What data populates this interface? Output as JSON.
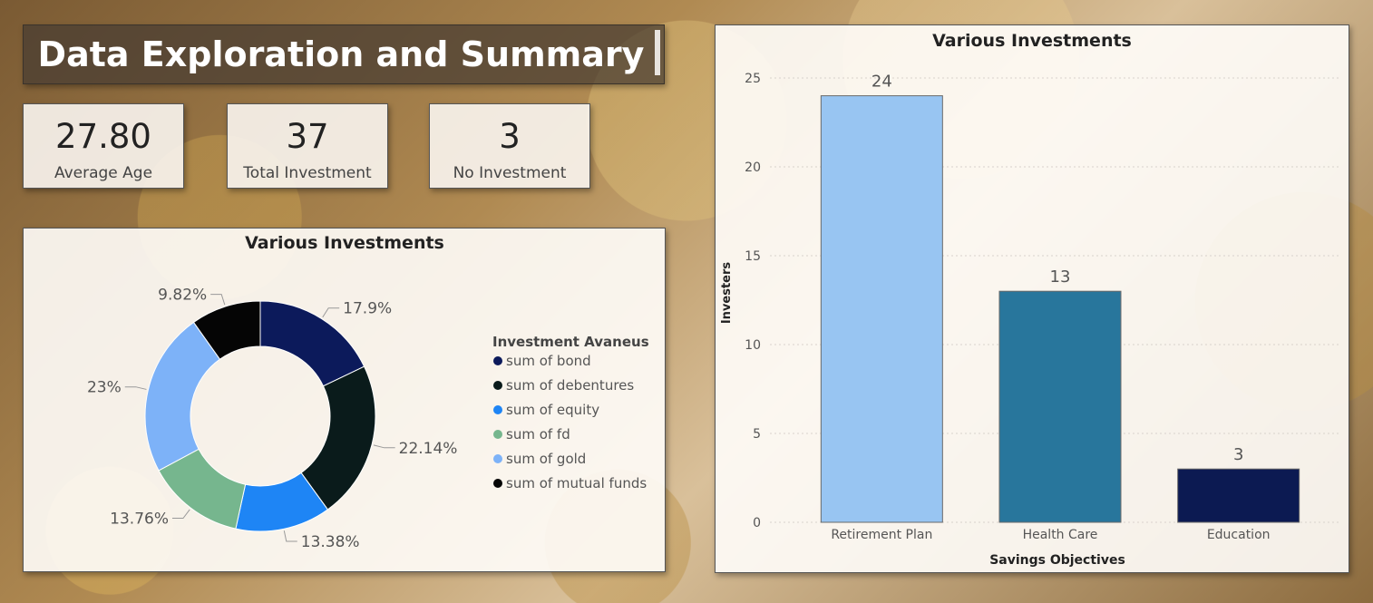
{
  "header": {
    "title": "Data Exploration and Summary"
  },
  "kpis": [
    {
      "value": "27.80",
      "label": "Average Age"
    },
    {
      "value": "37",
      "label": "Total Investment"
    },
    {
      "value": "3",
      "label": "No Investment"
    }
  ],
  "chart_data": [
    {
      "type": "pie",
      "variant": "donut",
      "title": "Various Investments",
      "legend_title": "Investment Avaneus",
      "legend_position": "right",
      "slices": [
        {
          "label": "sum of bond",
          "value": 17.9,
          "display": "17.9%",
          "color": "#0c1a5b"
        },
        {
          "label": "sum of debentures",
          "value": 22.14,
          "display": "22.14%",
          "color": "#0a1b1b"
        },
        {
          "label": "sum of equity",
          "value": 13.38,
          "display": "13.38%",
          "color": "#1e85f5"
        },
        {
          "label": "sum of fd",
          "value": 13.76,
          "display": "13.76%",
          "color": "#76b68e"
        },
        {
          "label": "sum of gold",
          "value": 23.0,
          "display": "23%",
          "color": "#7db2f8"
        },
        {
          "label": "sum of mutual funds",
          "value": 9.82,
          "display": "9.82%",
          "color": "#050505"
        }
      ]
    },
    {
      "type": "bar",
      "title": "Various Investments",
      "xlabel": "Savings Objectives",
      "ylabel": "Investers",
      "ylim": [
        0,
        25
      ],
      "yticks": [
        0,
        5,
        10,
        15,
        20,
        25
      ],
      "grid": true,
      "categories": [
        "Retirement Plan",
        "Health Care",
        "Education"
      ],
      "values": [
        24,
        13,
        3
      ],
      "colors": [
        "#98c5f2",
        "#28769c",
        "#0c1a52"
      ]
    }
  ]
}
